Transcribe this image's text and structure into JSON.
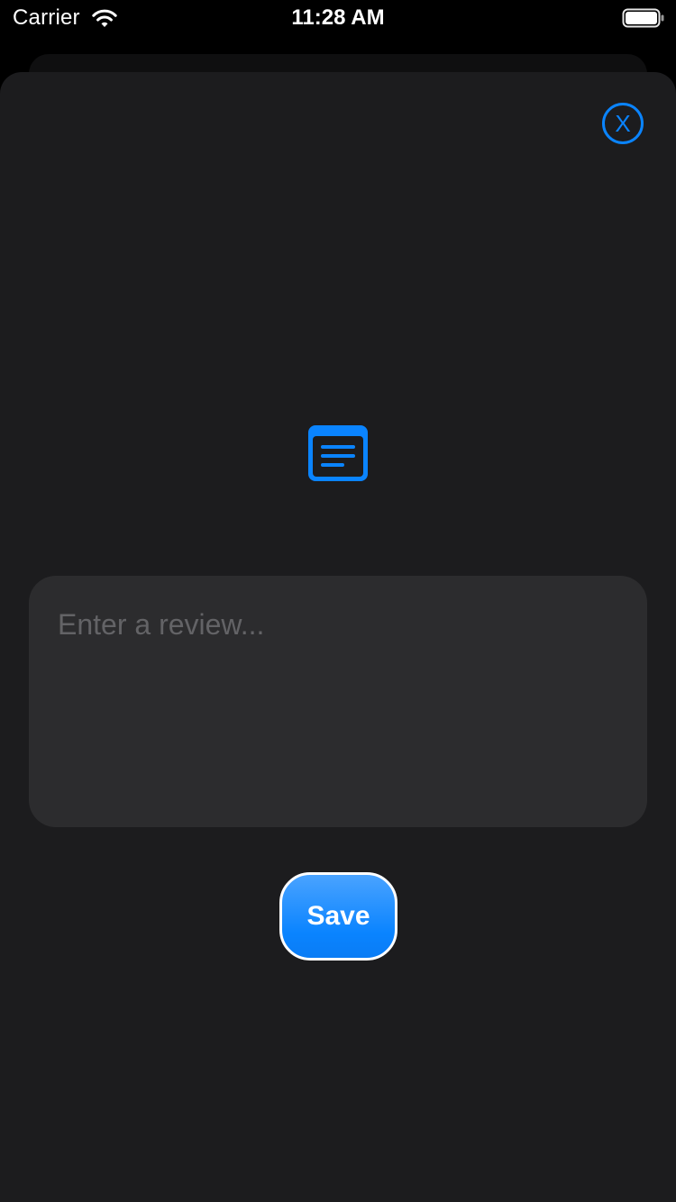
{
  "status_bar": {
    "carrier": "Carrier",
    "time": "11:28 AM",
    "wifi_icon": "wifi-icon",
    "battery_icon": "battery-icon"
  },
  "sheet": {
    "close_label": "X",
    "close_icon": "close-circle-icon",
    "header_icon": "text-document-icon",
    "review_placeholder": "Enter a review...",
    "review_value": "",
    "save_label": "Save"
  },
  "colors": {
    "accent": "#0a84ff",
    "sheet_background": "#1c1c1e",
    "input_background": "#2c2c2e",
    "placeholder": "#636366",
    "screen_background": "#000000"
  }
}
